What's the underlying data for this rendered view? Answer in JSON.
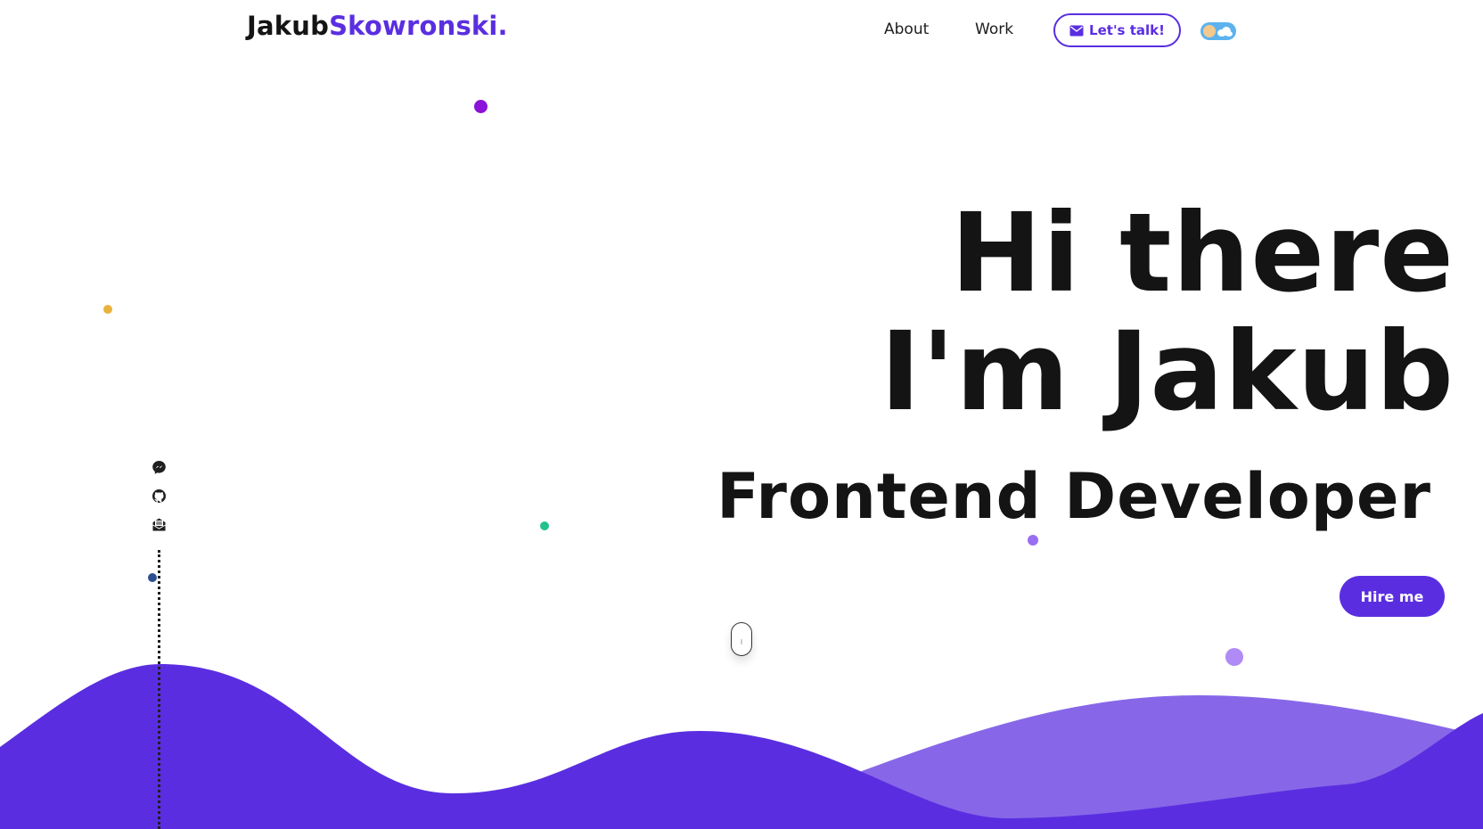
{
  "header": {
    "logo_first": "Jakub",
    "logo_second": "Skowronski."
  },
  "nav": {
    "about": "About",
    "work": "Work"
  },
  "cta": {
    "talk_label": "Let's talk!",
    "talk_icon": "envelope-icon"
  },
  "theme_toggle": {
    "icons": [
      "sun-icon",
      "cloud-icon"
    ]
  },
  "hero": {
    "line1": "Hi there",
    "line2": "I'm Jakub",
    "role": "Frontend Developer",
    "hire_label": "Hire me"
  },
  "social": {
    "icons": [
      "messenger-icon",
      "github-icon",
      "mail-icon"
    ]
  },
  "colors": {
    "accent": "#5a2ee0",
    "wave_light": "#8767e8",
    "text": "#141414",
    "dot_purple": "#8b12d8",
    "dot_yellow": "#e9b13d",
    "dot_green": "#22c38a",
    "dot_lavender": "#9a6ef0",
    "dot_navy": "#2d4f8f"
  }
}
